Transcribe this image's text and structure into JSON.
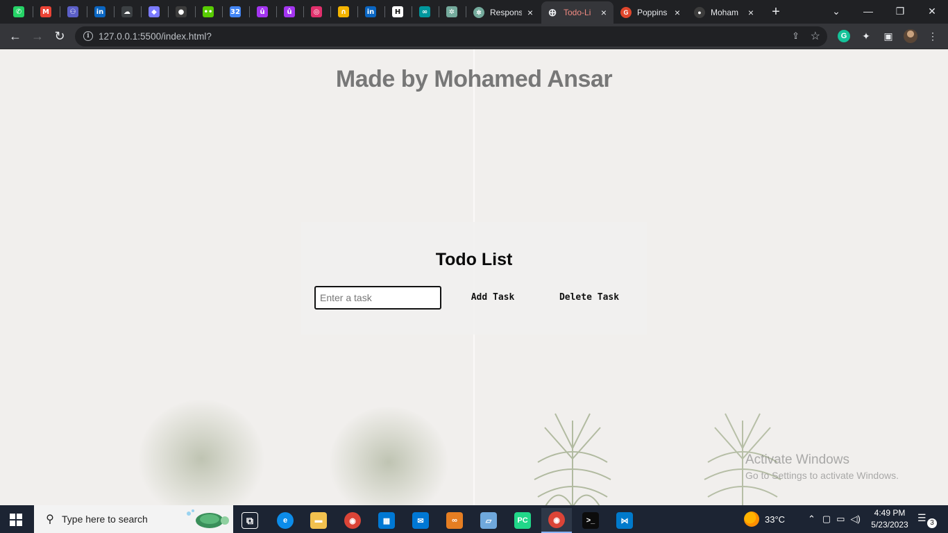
{
  "browser": {
    "pinned_tabs": [
      {
        "name": "whatsapp-icon",
        "glyph": "✆",
        "color": "#25d366"
      },
      {
        "name": "gmail-icon",
        "glyph": "M",
        "color": "#ea4335"
      },
      {
        "name": "teams-icon",
        "glyph": "⚇",
        "color": "#5b5fc7"
      },
      {
        "name": "linkedin-icon",
        "glyph": "in",
        "color": "#0a66c2"
      },
      {
        "name": "cloud-icon",
        "glyph": "☁",
        "color": "#3c4043"
      },
      {
        "name": "diamond-icon",
        "glyph": "◆",
        "color": "#7b7bff"
      },
      {
        "name": "github-icon",
        "glyph": "●",
        "color": "#3c3c3c"
      },
      {
        "name": "duolingo-icon",
        "glyph": "••",
        "color": "#58cc02"
      },
      {
        "name": "badge-32-icon",
        "glyph": "32",
        "color": "#4285f4"
      },
      {
        "name": "udemy-icon",
        "glyph": "û",
        "color": "#a435f0"
      },
      {
        "name": "udemy-icon-2",
        "glyph": "û",
        "color": "#a435f0"
      },
      {
        "name": "instagram-icon",
        "glyph": "◎",
        "color": "#e1306c"
      },
      {
        "name": "headphones-icon",
        "glyph": "∩",
        "color": "#f4b400"
      },
      {
        "name": "linkedin-icon-2",
        "glyph": "in",
        "color": "#0a66c2"
      },
      {
        "name": "hashnode-icon",
        "glyph": "H",
        "color": "#ffffff"
      },
      {
        "name": "arduino-icon",
        "glyph": "∞",
        "color": "#00979d"
      },
      {
        "name": "chatgpt-icon",
        "glyph": "✲",
        "color": "#74aa9c"
      }
    ],
    "tabs": [
      {
        "label": "Respons",
        "icon": "chatgpt-icon",
        "glyph": "✲",
        "color": "#74aa9c",
        "active": false
      },
      {
        "label": "Todo-Li",
        "icon": "globe-icon",
        "glyph": "⊕",
        "color": "#e8eaed",
        "active": true
      },
      {
        "label": "Poppins",
        "icon": "fonts-icon",
        "glyph": "G",
        "color": "#e0462c",
        "active": false
      },
      {
        "label": "Moham",
        "icon": "github-icon",
        "glyph": "●",
        "color": "#3c3c3c",
        "active": false
      }
    ],
    "tab_close": "×",
    "new_tab": "+",
    "window_controls": {
      "dropdown": "⌄",
      "minimize": "—",
      "restore": "❐",
      "close": "✕"
    },
    "nav": {
      "back": "←",
      "forward": "→",
      "reload": "↻"
    },
    "address": "127.0.0.1:5500/index.html?",
    "extensions": {
      "grammarly": "G",
      "puzzle": "✦",
      "sidepanel": "▣",
      "menu": "⋮"
    }
  },
  "page": {
    "title": "Made by Mohamed Ansar",
    "card_title": "Todo List",
    "input_placeholder": "Enter a task",
    "input_value": "",
    "add_button": "Add Task",
    "delete_button": "Delete Task",
    "watermark_title": "Activate Windows",
    "watermark_subtitle": "Go to Settings to activate Windows."
  },
  "taskbar": {
    "search_placeholder": "Type here to search",
    "apps": [
      {
        "name": "task-view-icon",
        "glyph": "⧉",
        "color": "#1c2433"
      },
      {
        "name": "edge-icon",
        "glyph": "e",
        "color": "#0c8ce9"
      },
      {
        "name": "file-explorer-icon",
        "glyph": "▬",
        "color": "#f2c14e"
      },
      {
        "name": "chrome-icon",
        "glyph": "◉",
        "color": "#db4437"
      },
      {
        "name": "ms-store-icon",
        "glyph": "▦",
        "color": "#0078d4"
      },
      {
        "name": "mail-icon",
        "glyph": "✉",
        "color": "#0078d4"
      },
      {
        "name": "infinity-app-icon",
        "glyph": "∞",
        "color": "#e67e22"
      },
      {
        "name": "notes-app-icon",
        "glyph": "▱",
        "color": "#6fa8dc"
      },
      {
        "name": "pycharm-icon",
        "glyph": "PC",
        "color": "#21d789"
      },
      {
        "name": "chrome-active-icon",
        "glyph": "◉",
        "color": "#db4437"
      },
      {
        "name": "terminal-icon",
        "glyph": ">_",
        "color": "#0c0c0c"
      },
      {
        "name": "vscode-icon",
        "glyph": "⋈",
        "color": "#007acc"
      }
    ],
    "weather": "33°C",
    "time": "4:49 PM",
    "date": "5/23/2023",
    "notification_count": "3"
  }
}
